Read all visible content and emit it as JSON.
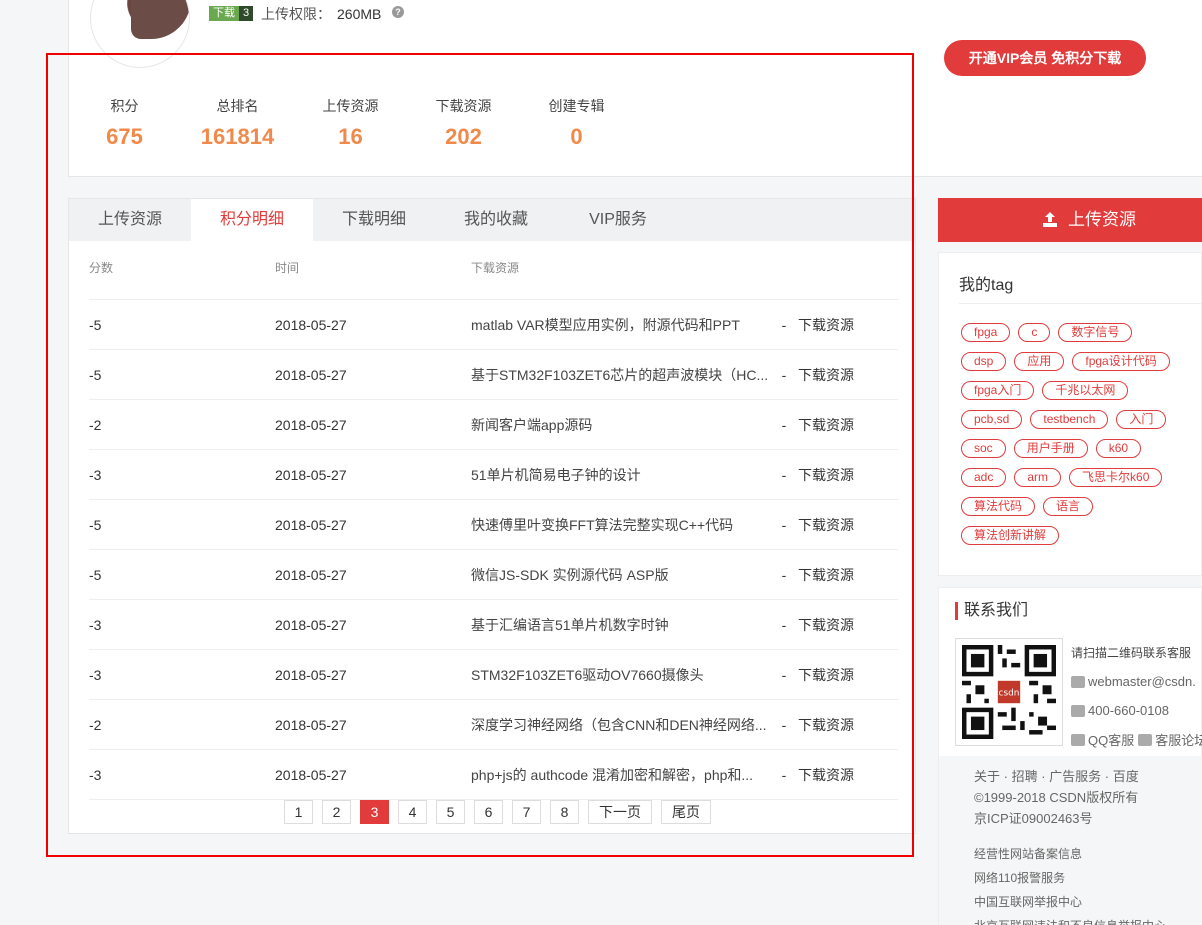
{
  "profile": {
    "badge_label": "下载",
    "badge_level": "3",
    "upload_limit_label": "上传权限：",
    "upload_limit_value": "260MB",
    "vip_button": "开通VIP会员 免积分下载",
    "stats": [
      {
        "label": "积分",
        "value": "675"
      },
      {
        "label": "总排名",
        "value": "161814"
      },
      {
        "label": "上传资源",
        "value": "16"
      },
      {
        "label": "下载资源",
        "value": "202"
      },
      {
        "label": "创建专辑",
        "value": "0"
      }
    ]
  },
  "tabs": [
    "上传资源",
    "积分明细",
    "下载明细",
    "我的收藏",
    "VIP服务"
  ],
  "active_tab": 1,
  "table": {
    "headers": {
      "score": "分数",
      "time": "时间",
      "resource": "下载资源"
    },
    "rows": [
      {
        "score": "-5",
        "time": "2018-05-27",
        "resource": "matlab VAR模型应用实例，附源代码和PPT",
        "link": "下载资源"
      },
      {
        "score": "-5",
        "time": "2018-05-27",
        "resource": "基于STM32F103ZET6芯片的超声波模块（HC...",
        "link": "下载资源"
      },
      {
        "score": "-2",
        "time": "2018-05-27",
        "resource": "新闻客户端app源码",
        "link": "下载资源"
      },
      {
        "score": "-3",
        "time": "2018-05-27",
        "resource": "51单片机简易电子钟的设计",
        "link": "下载资源"
      },
      {
        "score": "-5",
        "time": "2018-05-27",
        "resource": "快速傅里叶变换FFT算法完整实现C++代码",
        "link": "下载资源"
      },
      {
        "score": "-5",
        "time": "2018-05-27",
        "resource": "微信JS-SDK 实例源代码 ASP版",
        "link": "下载资源"
      },
      {
        "score": "-3",
        "time": "2018-05-27",
        "resource": "基于汇编语言51单片机数字时钟",
        "link": "下载资源"
      },
      {
        "score": "-3",
        "time": "2018-05-27",
        "resource": "STM32F103ZET6驱动OV7660摄像头",
        "link": "下载资源"
      },
      {
        "score": "-2",
        "time": "2018-05-27",
        "resource": "深度学习神经网络（包含CNN和DEN神经网络...",
        "link": "下载资源"
      },
      {
        "score": "-3",
        "time": "2018-05-27",
        "resource": "php+js的 authcode 混淆加密和解密，php和...",
        "link": "下载资源"
      }
    ]
  },
  "pagination": {
    "pages": [
      "1",
      "2",
      "3",
      "4",
      "5",
      "6",
      "7",
      "8"
    ],
    "current": "3",
    "next": "下一页",
    "last": "尾页"
  },
  "sidebar": {
    "upload_button": "上传资源",
    "tags_title": "我的tag",
    "tag_rows": [
      [
        "fpga",
        "c",
        "数字信号"
      ],
      [
        "dsp",
        "应用",
        "fpga设计代码"
      ],
      [
        "fpga入门",
        "千兆以太网"
      ],
      [
        "pcb,sd",
        "testbench",
        "入门"
      ],
      [
        "soc",
        "用户手册",
        "k60"
      ],
      [
        "adc",
        "arm",
        "飞思卡尔k60"
      ],
      [
        "算法代码",
        "语言"
      ],
      [
        "算法创新讲解"
      ]
    ],
    "contact_title": "联系我们",
    "contact_scan": "请扫描二维码联系客服",
    "contact_email": "webmaster@csdn.",
    "contact_phone": "400-660-0108",
    "contact_qq": "QQ客服",
    "contact_forum": "客服论坛",
    "footer_links": [
      "关于",
      "招聘",
      "广告服务",
      "百度"
    ],
    "copyright": "©1999-2018 CSDN版权所有",
    "icp": "京ICP证09002463号",
    "extra_links": [
      "经营性网站备案信息",
      "网络110报警服务",
      "中国互联网举报中心",
      "北京互联网违法和不良信息举报中心"
    ]
  },
  "colors": {
    "accent": "#e23b3b",
    "stat_number": "#f0894a"
  }
}
